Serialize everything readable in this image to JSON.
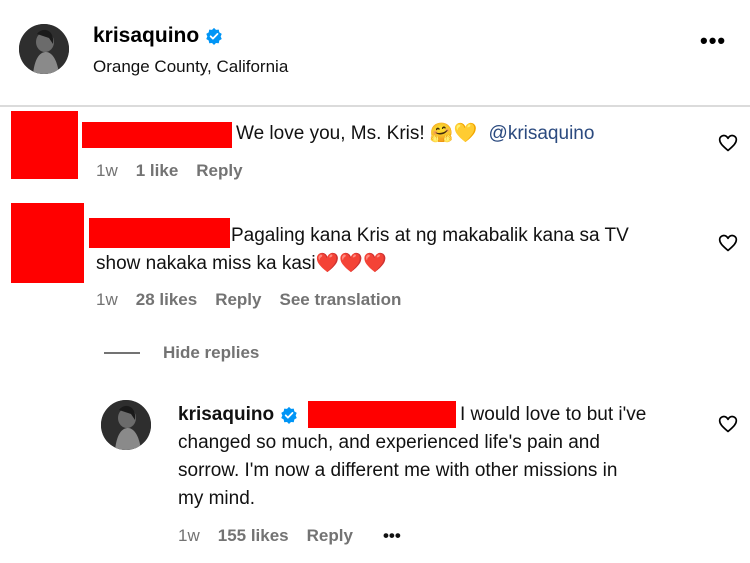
{
  "post": {
    "author": "krisaquino",
    "location": "Orange County, California",
    "more_label": "•••"
  },
  "comments": [
    {
      "text": "We love you, Ms. Kris! 🤗💛",
      "mention": "@krisaquino",
      "time": "1w",
      "likes": "1 like",
      "reply_label": "Reply"
    },
    {
      "text_line1": "Pagaling kana Kris at ng makabalik kana sa TV",
      "text_line2": "show nakaka miss ka kasi",
      "emojis": "❤️❤️❤️",
      "time": "1w",
      "likes": "28 likes",
      "reply_label": "Reply",
      "translation_label": "See translation"
    }
  ],
  "hide_replies_label": "Hide replies",
  "reply": {
    "author": "krisaquino",
    "text_line1": "I would love to but i've",
    "text_line2": "changed so much, and experienced life's pain and",
    "text_line3": "sorrow. I'm now a different me with other missions in",
    "text_line4": "my mind.",
    "time": "1w",
    "likes": "155 likes",
    "reply_label": "Reply",
    "more_label": "•••"
  },
  "colors": {
    "redaction": "#ff0000",
    "verified": "#0095f6",
    "muted": "#737373",
    "mention": "#2b4a7f"
  }
}
